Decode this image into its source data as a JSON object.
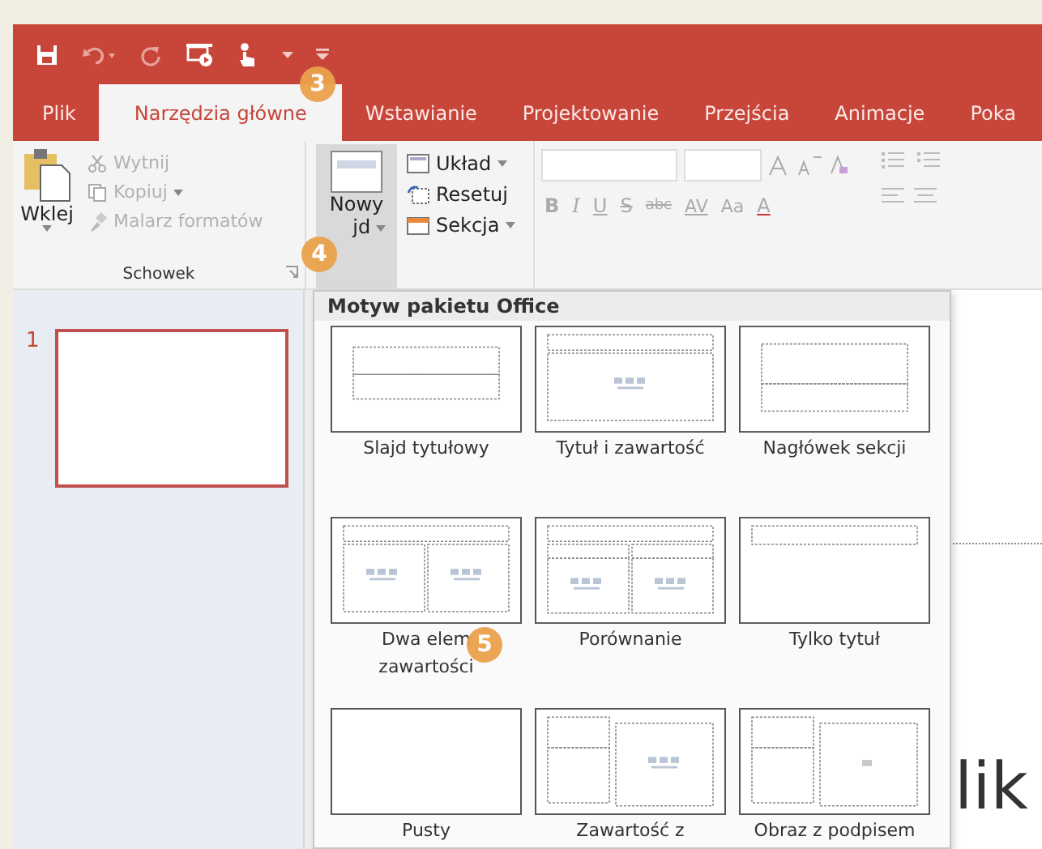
{
  "tabs": [
    {
      "label": "Plik",
      "selected": false
    },
    {
      "label": "Narzędzia główne",
      "selected": true
    },
    {
      "label": "Wstawianie",
      "selected": false
    },
    {
      "label": "Projektowanie",
      "selected": false
    },
    {
      "label": "Przejścia",
      "selected": false
    },
    {
      "label": "Animacje",
      "selected": false
    },
    {
      "label": "Poka",
      "selected": false
    }
  ],
  "clipboard": {
    "paste": "Wklej",
    "group_label": "Schowek",
    "items": [
      {
        "kind": "cut",
        "label": "Wytnij",
        "disabled": true
      },
      {
        "kind": "copy",
        "label": "Kopiuj",
        "disabled": true
      },
      {
        "kind": "painter",
        "label": "Malarz formatów",
        "disabled": true
      }
    ]
  },
  "slides_group": {
    "new_slide_lines": [
      "Nowy",
      "jd"
    ],
    "items": [
      {
        "kind": "layout",
        "label": "Układ"
      },
      {
        "kind": "reset",
        "label": "Resetuj"
      },
      {
        "kind": "section",
        "label": "Sekcja"
      }
    ]
  },
  "font_buttons": [
    "B",
    "I",
    "U",
    "S",
    "abc",
    "AV",
    "Aa",
    "A"
  ],
  "slide_pane": {
    "slides": [
      {
        "number": "1",
        "selected": true
      }
    ]
  },
  "gallery": {
    "title": "Motyw pakietu Office",
    "layouts": [
      {
        "kind": "title",
        "label_lines": [
          "Slajd tytułowy"
        ]
      },
      {
        "kind": "title-content",
        "label_lines": [
          "Tytuł i zawartość"
        ]
      },
      {
        "kind": "section",
        "label_lines": [
          "Nagłówek sekcji"
        ]
      },
      {
        "kind": "two-content",
        "label_lines": [
          "Dwa elem",
          "zawartości"
        ]
      },
      {
        "kind": "comparison",
        "label_lines": [
          "Porównanie"
        ]
      },
      {
        "kind": "title-only",
        "label_lines": [
          "Tylko tytuł"
        ]
      },
      {
        "kind": "blank",
        "label_lines": [
          "Pusty"
        ]
      },
      {
        "kind": "content-caption",
        "label_lines": [
          "Zawartość z"
        ]
      },
      {
        "kind": "picture-caption",
        "label_lines": [
          "Obraz z podpisem"
        ]
      }
    ]
  },
  "editor": {
    "placeholder_text": "lik"
  },
  "callouts": [
    "3",
    "4",
    "5"
  ]
}
